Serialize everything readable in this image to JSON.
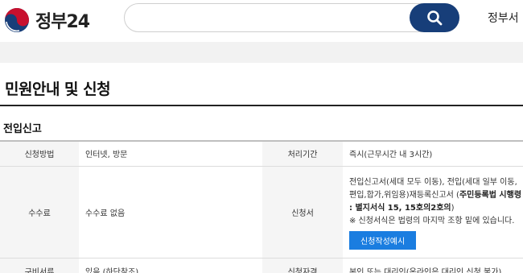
{
  "header": {
    "logo_text": "정부24",
    "search_placeholder": "",
    "nav_partial": "정부서"
  },
  "page_title": "민원안내 및 신청",
  "section_title": "전입신고",
  "table": {
    "row1": {
      "method_label": "신청방법",
      "method_value": "인터넷, 방문",
      "period_label": "처리기간",
      "period_value": "즉시(근무시간 내 3시간)"
    },
    "row2": {
      "fee_label": "수수료",
      "fee_value": "수수료 없음",
      "form_label": "신청서",
      "form_text_1": "전입신고서(세대 모두 이동), 전입(세대 일부 이동,",
      "form_text_2": "편입,합가,위임용)재등록신고서 (",
      "form_text_bold": "주민등록법 시행령 : 별지서식 15, 15호의2호의",
      "form_text_3": ")",
      "form_note": "※ 신청서식은 법령의 마지막 조항 밑에 있습니다.",
      "form_example_button": "신청작성예시"
    },
    "row3": {
      "docs_label": "구비서류",
      "docs_value": "있음 (하단참조)",
      "eligibility_label": "신청자격",
      "eligibility_value": "본인 또는 대리인(온라인은 대리인 신청 불가)"
    }
  },
  "colors": {
    "brand_blue": "#173e79",
    "button_blue": "#1a7de0",
    "logo_red": "#c8102e"
  }
}
